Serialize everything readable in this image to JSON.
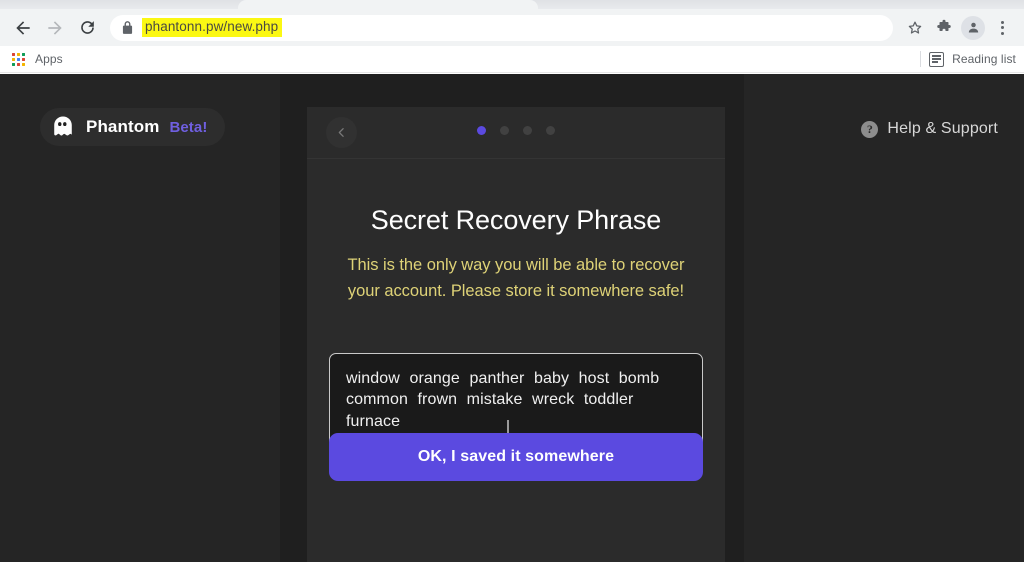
{
  "browser": {
    "nav": {
      "back_label": "Back",
      "forward_label": "Forward",
      "reload_label": "Reload"
    },
    "omnibox": {
      "url": "phantonn.pw/new.php",
      "placeholder": "Search Google or type a URL",
      "lock_icon": "lock-icon",
      "highlight_color": "#fbf813"
    },
    "toolbar_right": {
      "bookmark_icon": "star-icon",
      "extensions_icon": "puzzle-icon",
      "profile_icon": "avatar-icon",
      "menu_icon": "kebab-menu-icon"
    },
    "bookmarks_bar": {
      "apps_label": "Apps",
      "apps_icon": "apps-grid-icon",
      "reading_list_label": "Reading list",
      "reading_list_icon": "reading-list-icon"
    }
  },
  "page": {
    "background_color": "#1f1f1f",
    "brand": {
      "icon": "ghost-icon",
      "name": "Phantom",
      "beta_label": "Beta!",
      "beta_color": "#6f5fe0"
    },
    "help": {
      "icon": "question-circle-icon",
      "label": "Help & Support"
    },
    "card": {
      "back_icon": "chevron-left-icon",
      "steps": {
        "total": 4,
        "active_index": 0,
        "active_color": "#5b4ae0",
        "inactive_color": "#414141"
      },
      "title": "Secret Recovery Phrase",
      "warning": "This is the only way you will be able to recover your account. Please store it somewhere safe!",
      "warning_color": "#ded277",
      "seed_phrase": "window orange panther baby host bomb common frown mistake wreck toddler furnace",
      "seed_words": [
        "window",
        "orange",
        "panther",
        "baby",
        "host",
        "bomb",
        "common",
        "frown",
        "mistake",
        "wreck",
        "toddler",
        "furnace"
      ],
      "confirm_button": "OK, I saved it somewhere",
      "confirm_button_color": "#5b4ae0"
    }
  }
}
